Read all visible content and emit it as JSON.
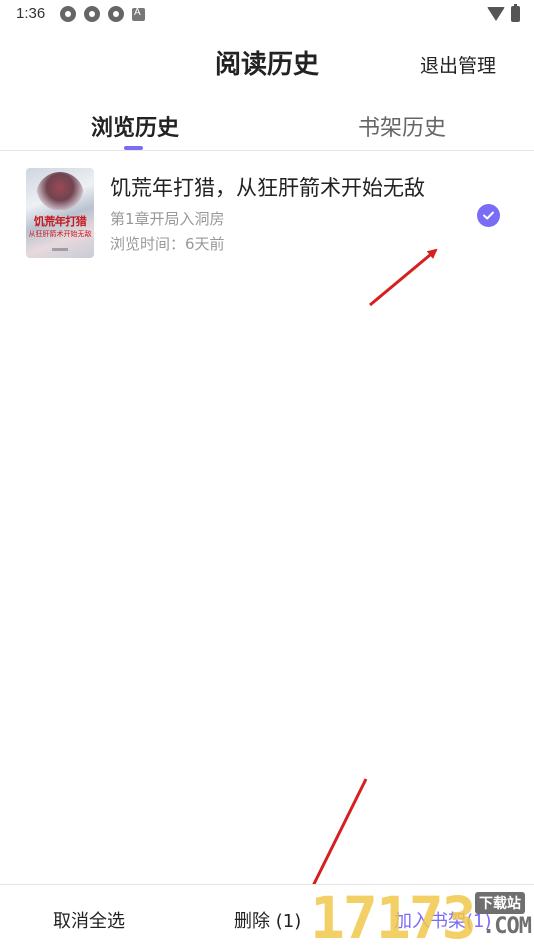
{
  "status_bar": {
    "time": "1:36",
    "icons": [
      "sync-icon",
      "sync-icon",
      "sync-icon",
      "a-icon",
      "wifi-icon",
      "battery-icon"
    ]
  },
  "header": {
    "title": "阅读历史",
    "exit_manage_label": "退出管理"
  },
  "tabs": [
    {
      "label": "浏览历史",
      "active": true
    },
    {
      "label": "书架历史",
      "active": false
    }
  ],
  "books": [
    {
      "title": "饥荒年打猎，从狂肝箭术开始无敌",
      "chapter": "第1章开局入洞房",
      "browse_time": "浏览时间：6天前",
      "selected": true,
      "cover": {
        "title": "饥荒年打猎",
        "subtitle": "从狂肝箭术开始无敌"
      }
    }
  ],
  "bottom_bar": {
    "cancel_select_all": "取消全选",
    "delete_label": "删除 (1)",
    "add_to_shelf_label": "加入书架(1)"
  },
  "watermark": {
    "digits": "17173",
    "tag": "下载站",
    "suffix": ".COM"
  },
  "colors": {
    "accent": "#7b6cf6",
    "annotation_arrow": "#d61f1f",
    "watermark_yellow": "#f1c84c"
  }
}
